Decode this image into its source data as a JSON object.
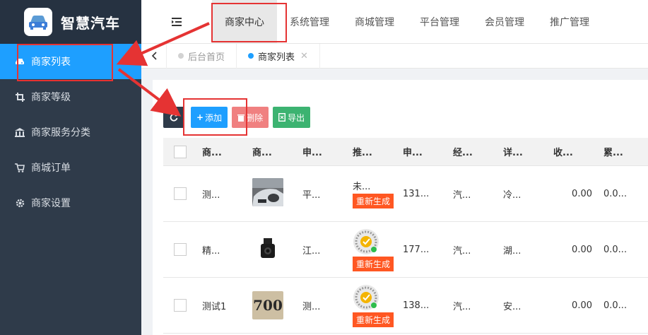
{
  "app": {
    "title": "智慧汽车"
  },
  "sidebar": {
    "items": [
      {
        "label": "商家列表",
        "icon": "car-icon",
        "active": true
      },
      {
        "label": "商家等级",
        "icon": "crop-icon",
        "active": false
      },
      {
        "label": "商家服务分类",
        "icon": "bank-icon",
        "active": false
      },
      {
        "label": "商城订单",
        "icon": "cart-icon",
        "active": false
      },
      {
        "label": "商家设置",
        "icon": "gear-icon",
        "active": false
      }
    ]
  },
  "topnav": {
    "tabs": [
      "商家中心",
      "系统管理",
      "商城管理",
      "平台管理",
      "会员管理",
      "推广管理"
    ],
    "active": "商家中心"
  },
  "pagetabs": {
    "tabs": [
      "后台首页",
      "商家列表"
    ],
    "active": "商家列表"
  },
  "toolbar": {
    "add_label": "添加",
    "delete_label": "删除",
    "export_label": "导出"
  },
  "table": {
    "headers": [
      "商...",
      "商...",
      "申...",
      "推...",
      "申...",
      "经...",
      "详...",
      "收...",
      "累..."
    ],
    "regen_label": "重新生成",
    "rows": [
      {
        "name": "测...",
        "thumb": "car-repair",
        "apply": "平...",
        "promo_text": "未...",
        "phone": "131...",
        "biz": "汽...",
        "detail": "冷...",
        "income": "0.00",
        "total": "0.0..."
      },
      {
        "name": "精...",
        "thumb": "dashcam",
        "apply": "江...",
        "promo_text": "",
        "phone": "177...",
        "biz": "汽...",
        "detail": "湖...",
        "income": "0.00",
        "total": "0.0..."
      },
      {
        "name": "测试1",
        "thumb": "number-700",
        "thumb_text": "700",
        "apply": "测...",
        "promo_text": "",
        "phone": "138...",
        "biz": "汽...",
        "detail": "安...",
        "income": "0.00",
        "total": "0.0..."
      }
    ]
  },
  "colors": {
    "sidebar": "#2f3b4a",
    "accent": "#1e9fff",
    "danger": "#f08080",
    "success": "#3cb371",
    "regen": "#ff5722",
    "annotation": "#e53333"
  }
}
